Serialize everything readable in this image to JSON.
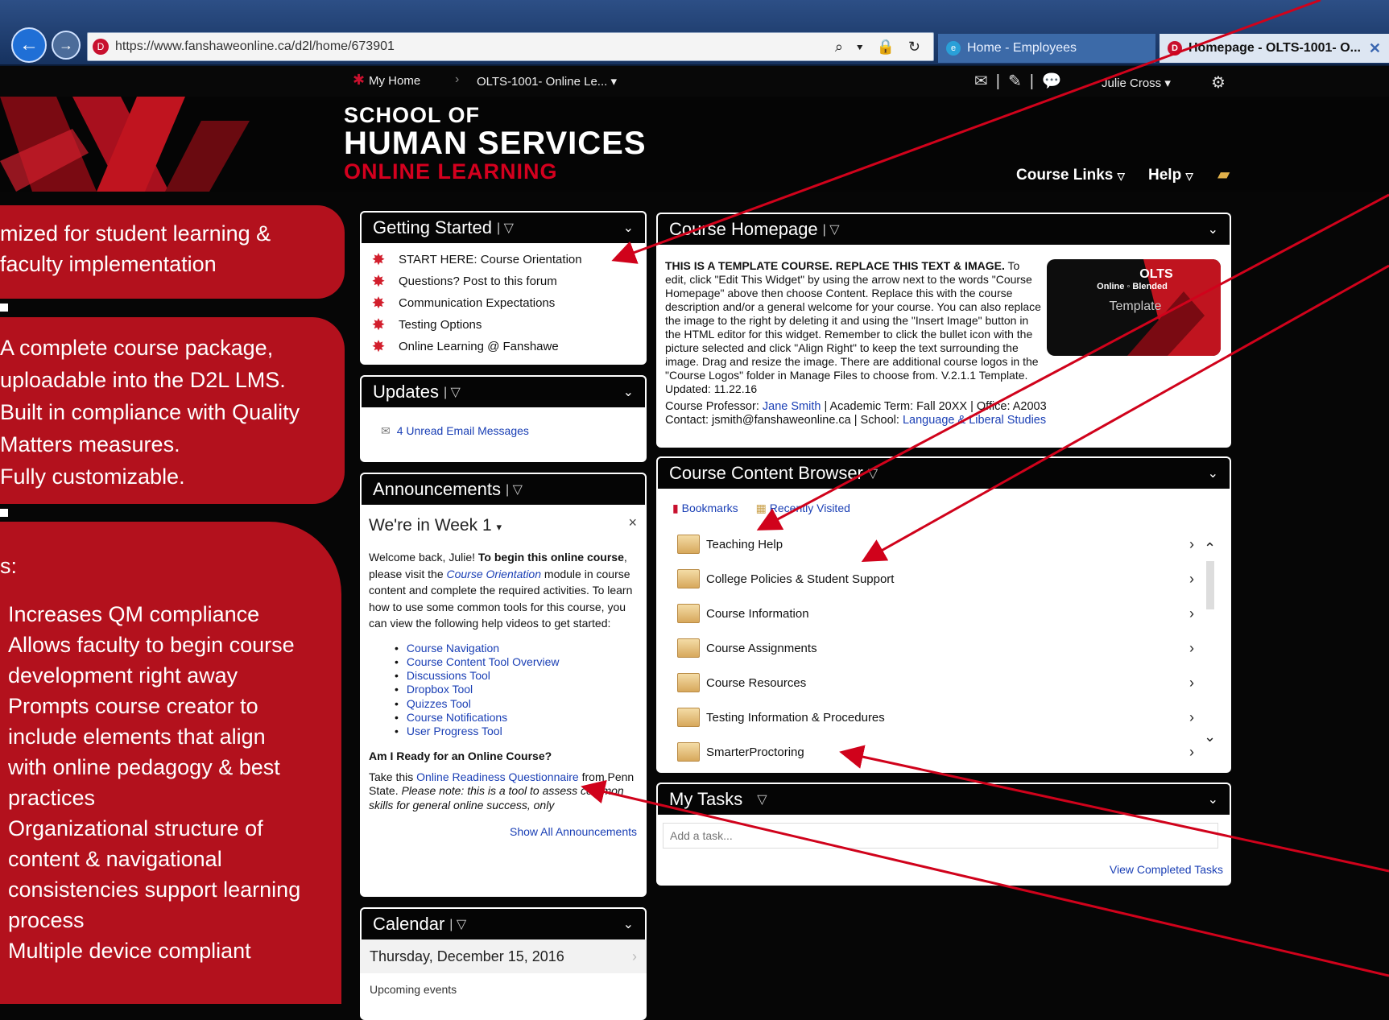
{
  "browser": {
    "url": "https://www.fanshaweonline.ca/d2l/home/673901",
    "addr_tools": "⌕ ▾ 🔒 ↻",
    "tabs": [
      "Home - Employees",
      "Homepage - OLTS-1001- O..."
    ],
    "tab_close": "✕"
  },
  "navbar": {
    "home": "My Home",
    "course": "OLTS-1001- Online Le...",
    "user": "Julie Cross"
  },
  "banner": {
    "line1": "SCHOOL OF",
    "line2": "HUMAN SERVICES",
    "line3": "ONLINE LEARNING",
    "course_links": "Course Links",
    "help": "Help"
  },
  "callouts": {
    "c1": [
      "mized for student learning &",
      "faculty implementation"
    ],
    "c2": [
      "A complete course package,",
      "uploadable into the D2L LMS.",
      "Built in compliance with Quality",
      "Matters measures.",
      "Fully customizable."
    ],
    "c3_heading": "s:",
    "c3_items": [
      "Increases QM compliance",
      "Allows faculty to begin course",
      "development right away",
      "Prompts course creator to",
      "include elements that align",
      "with online pedagogy & best",
      "practices",
      "Organizational structure of",
      "content & navigational",
      "consistencies support learning",
      "process",
      "Multiple device compliant"
    ]
  },
  "getting_started": {
    "title": "Getting Started",
    "items": [
      "START HERE: Course Orientation",
      "Questions? Post to this forum",
      "Communication Expectations",
      "Testing Options",
      "Online Learning @ Fanshawe"
    ]
  },
  "updates": {
    "title": "Updates",
    "email": "4 Unread Email Messages"
  },
  "announcements": {
    "title": "Announcements",
    "week": "We're in Week 1",
    "close": "×",
    "intro_a": "Welcome back, Julie! ",
    "intro_b": "To begin this online course",
    "intro_c": ", please visit the ",
    "intro_link": "Course Orientation",
    "intro_d": " module in course content and complete the required activities. To learn how to use some common tools for this course, you can view the following help videos to get started:",
    "videos": [
      "Course Navigation",
      "Course Content Tool Overview",
      "Discussions Tool",
      "Dropbox Tool",
      "Quizzes Tool",
      "Course Notifications",
      "User Progress Tool"
    ],
    "ready_heading": "Am I Ready for an Online Course?",
    "ready_a": "Take this ",
    "ready_link": "Online Readiness Questionnaire",
    "ready_b": " from Penn State. ",
    "ready_note": "Please note: this is a tool to assess common skills for general online success, only",
    "show_all": "Show All Announcements"
  },
  "calendar": {
    "title": "Calendar",
    "date": "Thursday, December 15, 2016",
    "upcoming": "Upcoming events"
  },
  "course_homepage": {
    "title": "Course Homepage",
    "heading": "THIS IS A TEMPLATE COURSE. REPLACE THIS TEXT & IMAGE.",
    "body": "To edit, click \"Edit This Widget\" by using the arrow next to the words \"Course Homepage\" above then choose Content. Replace this with the course description and/or a general welcome for your course. You can also replace the image to the right by deleting it and using the \"Insert Image\" button in the HTML editor for this widget. Remember to click the bullet icon with the picture selected and click \"Align Right\" to keep the text surrounding the image. Drag and resize the image. There are additional course logos in the \"Course Logos\" folder in Manage Files to choose from. V.2.1.1 Template. Updated: 11.22.16",
    "logo_title": "OLTS",
    "logo_sub": "Online ◦ Blended",
    "logo_template": "Template",
    "prof_label": "Course Professor: ",
    "prof_name": "Jane Smith",
    "term": " | Academic Term: Fall 20XX | Office: A2003",
    "contact": "Contact: jsmith@fanshaweonline.ca | School: ",
    "school_link": "Language & Liberal Studies"
  },
  "content_browser": {
    "title": "Course Content Browser",
    "bookmarks": "Bookmarks",
    "recent": "Recently Visited",
    "modules": [
      "Teaching Help",
      "College Policies & Student Support",
      "Course Information",
      "Course Assignments",
      "Course Resources",
      "Testing Information & Procedures",
      "SmarterProctoring"
    ]
  },
  "tasks": {
    "title": "My Tasks",
    "placeholder": "Add a task...",
    "view_completed": "View Completed Tasks"
  },
  "colors": {
    "brand_red": "#b3111d",
    "link_blue": "#1a3fb5",
    "arrow_red": "#d0021b"
  }
}
